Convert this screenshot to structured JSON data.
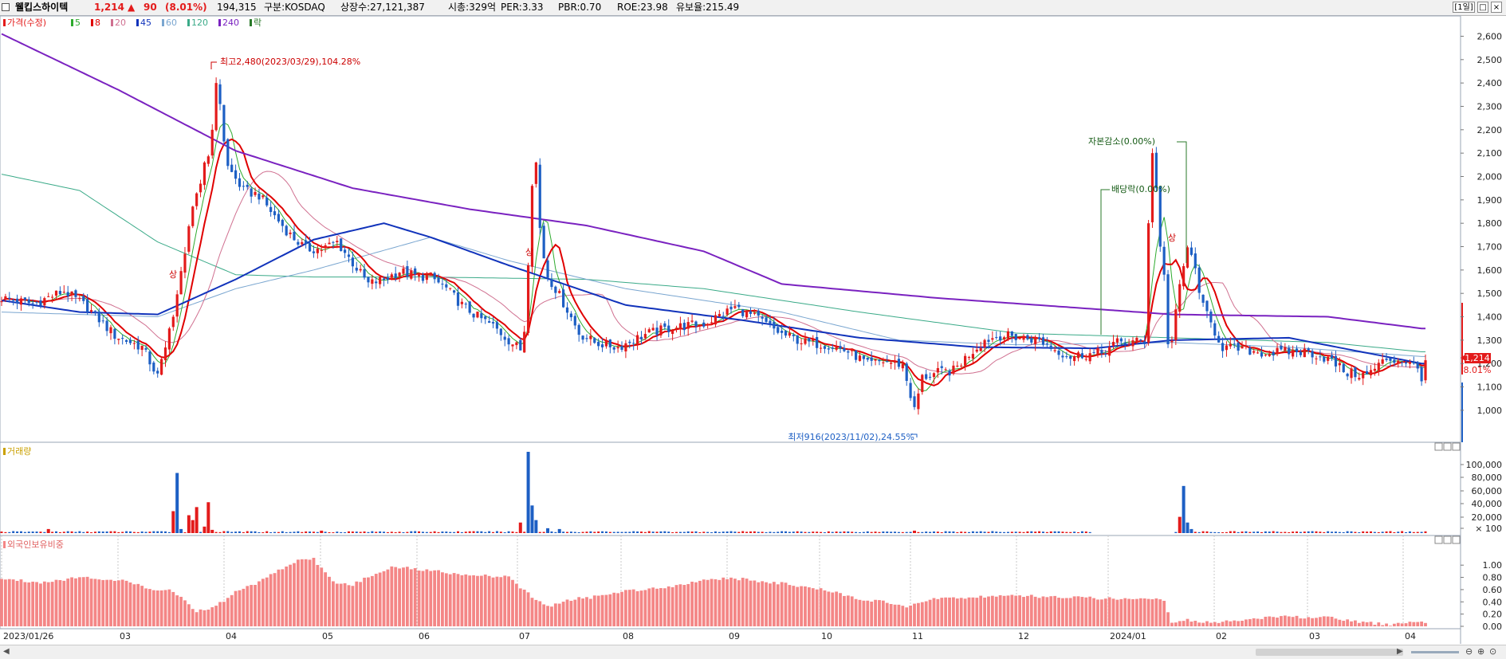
{
  "header": {
    "stock_name": "웰킵스하이텍",
    "price": "1,214",
    "change_arrow": "▲",
    "change": "90",
    "change_pct": "(8.01%)",
    "volume": "194,315",
    "market": "구분:KOSDAQ",
    "listed_shares": "상장수:27,121,387",
    "market_cap": "시총:329억",
    "per": "PER:3.33",
    "pbr": "PBR:0.70",
    "roe": "ROE:23.98",
    "reserve_ratio": "유보율:215.49",
    "period_button": "[1일]"
  },
  "legend": {
    "price_label": "가격(수정)",
    "ma": [
      {
        "label": "5",
        "color": "#2eaa2e"
      },
      {
        "label": "8",
        "color": "#e00000"
      },
      {
        "label": "20",
        "color": "#d07090"
      },
      {
        "label": "45",
        "color": "#1133bb"
      },
      {
        "label": "60",
        "color": "#7aa6d0"
      },
      {
        "label": "120",
        "color": "#3aaa88"
      },
      {
        "label": "240",
        "color": "#7a22c0"
      }
    ],
    "drop_label": "락",
    "volume_label": "거래량",
    "foreign_label": "외국인보유비중"
  },
  "annotations": {
    "high": "최고2,480(2023/03/29),104.28%",
    "low": "최저916(2023/11/02),24.55%",
    "capital_reduction": "자본감소(0.00%)",
    "dividend_drop": "배당락(0.00%)",
    "upper_limit": "상"
  },
  "current": {
    "price_tag": "1,214",
    "pct_tag": "8.01%"
  },
  "colors": {
    "up": "#e31b1b",
    "down": "#1d5fc4",
    "foreign_bar": "#f48686",
    "ma240": "#7a22c0",
    "ma45": "#1133bb"
  },
  "chart_data": {
    "type": "candlestick",
    "price_axis": {
      "ticks": [
        "1,000",
        "1,100",
        "1,200",
        "1,300",
        "1,400",
        "1,500",
        "1,600",
        "1,700",
        "1,800",
        "1,900",
        "2,000",
        "2,100",
        "2,200",
        "2,300",
        "2,400",
        "2,500",
        "2,600"
      ],
      "ylim": [
        870,
        2680
      ]
    },
    "volume_axis": {
      "ticks": [
        "100,000",
        "80,000",
        "60,000",
        "40,000",
        "20,000",
        "× 100"
      ]
    },
    "foreign_axis": {
      "ticks": [
        "1.00",
        "0.80",
        "0.60",
        "0.40",
        "0.20",
        "0.00"
      ],
      "ylim": [
        0,
        1.25
      ]
    },
    "x_labels": [
      "2023/01/26",
      "03",
      "04",
      "05",
      "06",
      "07",
      "08",
      "09",
      "10",
      "11",
      "12",
      "2024/01",
      "02",
      "03",
      "04"
    ],
    "price_anchors": [
      [
        0,
        1480
      ],
      [
        8,
        1455
      ],
      [
        16,
        1510
      ],
      [
        22,
        1440
      ],
      [
        29,
        1320
      ],
      [
        36,
        1270
      ],
      [
        40,
        1145
      ],
      [
        44,
        1380
      ],
      [
        48,
        1790
      ],
      [
        52,
        2030
      ],
      [
        55,
        2200
      ],
      [
        58,
        2040
      ],
      [
        62,
        1940
      ],
      [
        66,
        1920
      ],
      [
        70,
        1830
      ],
      [
        74,
        1750
      ],
      [
        78,
        1690
      ],
      [
        82,
        1690
      ],
      [
        86,
        1720
      ],
      [
        90,
        1630
      ],
      [
        94,
        1540
      ],
      [
        98,
        1560
      ],
      [
        102,
        1595
      ],
      [
        106,
        1575
      ],
      [
        110,
        1570
      ],
      [
        114,
        1520
      ],
      [
        118,
        1450
      ],
      [
        122,
        1400
      ],
      [
        126,
        1360
      ],
      [
        130,
        1300
      ],
      [
        133,
        1260
      ],
      [
        135,
        1430
      ],
      [
        137,
        1720
      ],
      [
        139,
        1600
      ],
      [
        142,
        1520
      ],
      [
        145,
        1430
      ],
      [
        148,
        1330
      ],
      [
        152,
        1290
      ],
      [
        158,
        1270
      ],
      [
        165,
        1325
      ],
      [
        172,
        1355
      ],
      [
        180,
        1370
      ],
      [
        188,
        1440
      ],
      [
        194,
        1390
      ],
      [
        200,
        1325
      ],
      [
        206,
        1290
      ],
      [
        212,
        1280
      ],
      [
        218,
        1245
      ],
      [
        222,
        1195
      ],
      [
        226,
        1210
      ],
      [
        231,
        1195
      ],
      [
        234,
        1000
      ],
      [
        236,
        1140
      ],
      [
        240,
        1160
      ],
      [
        244,
        1170
      ],
      [
        248,
        1240
      ],
      [
        252,
        1300
      ],
      [
        256,
        1320
      ],
      [
        262,
        1310
      ],
      [
        266,
        1300
      ],
      [
        270,
        1260
      ],
      [
        274,
        1230
      ],
      [
        278,
        1240
      ],
      [
        282,
        1245
      ],
      [
        286,
        1290
      ],
      [
        294,
        1295
      ],
      [
        300,
        1295
      ],
      [
        302,
        1530
      ],
      [
        304,
        1700
      ],
      [
        306,
        1600
      ],
      [
        308,
        1440
      ],
      [
        310,
        1370
      ],
      [
        313,
        1270
      ],
      [
        318,
        1260
      ],
      [
        324,
        1245
      ],
      [
        330,
        1250
      ],
      [
        335,
        1250
      ],
      [
        340,
        1220
      ],
      [
        345,
        1160
      ],
      [
        350,
        1150
      ],
      [
        355,
        1220
      ],
      [
        360,
        1210
      ],
      [
        364,
        1165
      ]
    ],
    "spikes": [
      [
        43,
        1350
      ],
      [
        44,
        1400
      ],
      [
        52,
        2060
      ],
      [
        54,
        2200
      ],
      [
        55,
        2400
      ],
      [
        56,
        2310
      ],
      [
        57,
        2150
      ],
      [
        135,
        1620
      ],
      [
        136,
        1960
      ],
      [
        137,
        2060
      ],
      [
        138,
        1780
      ],
      [
        139,
        1650
      ],
      [
        294,
        1800
      ],
      [
        295,
        2100
      ],
      [
        296,
        1950
      ],
      [
        297,
        1700
      ],
      [
        298,
        1580
      ]
    ],
    "ma240_anchors": [
      [
        0,
        2610
      ],
      [
        30,
        2370
      ],
      [
        60,
        2110
      ],
      [
        90,
        1950
      ],
      [
        120,
        1860
      ],
      [
        150,
        1790
      ],
      [
        180,
        1680
      ],
      [
        200,
        1540
      ],
      [
        240,
        1480
      ],
      [
        300,
        1410
      ],
      [
        340,
        1400
      ],
      [
        364,
        1350
      ]
    ],
    "ma45_anchors": [
      [
        0,
        1470
      ],
      [
        20,
        1420
      ],
      [
        40,
        1410
      ],
      [
        60,
        1560
      ],
      [
        80,
        1730
      ],
      [
        98,
        1800
      ],
      [
        110,
        1740
      ],
      [
        130,
        1620
      ],
      [
        160,
        1450
      ],
      [
        190,
        1385
      ],
      [
        220,
        1310
      ],
      [
        250,
        1270
      ],
      [
        280,
        1265
      ],
      [
        300,
        1300
      ],
      [
        330,
        1310
      ],
      [
        364,
        1200
      ]
    ],
    "ma120_anchors": [
      [
        0,
        2010
      ],
      [
        20,
        1940
      ],
      [
        40,
        1720
      ],
      [
        60,
        1580
      ],
      [
        80,
        1570
      ],
      [
        110,
        1570
      ],
      [
        150,
        1560
      ],
      [
        180,
        1520
      ],
      [
        220,
        1420
      ],
      [
        260,
        1330
      ],
      [
        300,
        1310
      ],
      [
        340,
        1290
      ],
      [
        364,
        1250
      ]
    ],
    "ma60_anchors": [
      [
        0,
        1420
      ],
      [
        40,
        1400
      ],
      [
        60,
        1520
      ],
      [
        80,
        1600
      ],
      [
        110,
        1740
      ],
      [
        130,
        1640
      ],
      [
        160,
        1520
      ],
      [
        200,
        1420
      ],
      [
        230,
        1300
      ],
      [
        260,
        1280
      ],
      [
        300,
        1290
      ],
      [
        330,
        1270
      ],
      [
        364,
        1230
      ]
    ],
    "foreign_anchors": [
      [
        0,
        0.78
      ],
      [
        10,
        0.72
      ],
      [
        20,
        0.8
      ],
      [
        30,
        0.76
      ],
      [
        38,
        0.62
      ],
      [
        44,
        0.58
      ],
      [
        50,
        0.24
      ],
      [
        55,
        0.33
      ],
      [
        60,
        0.56
      ],
      [
        65,
        0.7
      ],
      [
        70,
        0.88
      ],
      [
        76,
        1.08
      ],
      [
        80,
        1.1
      ],
      [
        85,
        0.72
      ],
      [
        90,
        0.68
      ],
      [
        96,
        0.86
      ],
      [
        100,
        0.98
      ],
      [
        110,
        0.91
      ],
      [
        120,
        0.84
      ],
      [
        130,
        0.8
      ],
      [
        136,
        0.48
      ],
      [
        140,
        0.32
      ],
      [
        146,
        0.44
      ],
      [
        152,
        0.48
      ],
      [
        160,
        0.58
      ],
      [
        170,
        0.64
      ],
      [
        182,
        0.78
      ],
      [
        190,
        0.77
      ],
      [
        200,
        0.7
      ],
      [
        206,
        0.64
      ],
      [
        212,
        0.58
      ],
      [
        220,
        0.45
      ],
      [
        226,
        0.4
      ],
      [
        232,
        0.3
      ],
      [
        236,
        0.4
      ],
      [
        240,
        0.46
      ],
      [
        260,
        0.5
      ],
      [
        280,
        0.46
      ],
      [
        298,
        0.44
      ],
      [
        300,
        0.04
      ],
      [
        304,
        0.1
      ],
      [
        310,
        0.06
      ],
      [
        320,
        0.12
      ],
      [
        330,
        0.16
      ],
      [
        340,
        0.14
      ],
      [
        350,
        0.06
      ],
      [
        356,
        0.02
      ],
      [
        364,
        0.07
      ]
    ],
    "volume_spikes": [
      [
        44,
        0.27,
        "up"
      ],
      [
        45,
        0.74,
        "down"
      ],
      [
        46,
        0.05,
        "down"
      ],
      [
        48,
        0.22,
        "up"
      ],
      [
        49,
        0.16,
        "up"
      ],
      [
        50,
        0.32,
        "up"
      ],
      [
        52,
        0.08,
        "up"
      ],
      [
        53,
        0.38,
        "up"
      ],
      [
        54,
        0.04,
        "up"
      ],
      [
        133,
        0.13,
        "up"
      ],
      [
        135,
        1.0,
        "down"
      ],
      [
        136,
        0.34,
        "down"
      ],
      [
        137,
        0.16,
        "down"
      ],
      [
        140,
        0.06,
        "down"
      ],
      [
        143,
        0.05,
        "down"
      ],
      [
        12,
        0.05,
        "up"
      ],
      [
        82,
        0.03,
        "up"
      ],
      [
        234,
        0.03,
        "up"
      ],
      [
        302,
        0.2,
        "up"
      ],
      [
        303,
        0.58,
        "down"
      ],
      [
        304,
        0.13,
        "down"
      ],
      [
        305,
        0.05,
        "down"
      ]
    ]
  },
  "window_buttons": [
    "□",
    "×"
  ]
}
